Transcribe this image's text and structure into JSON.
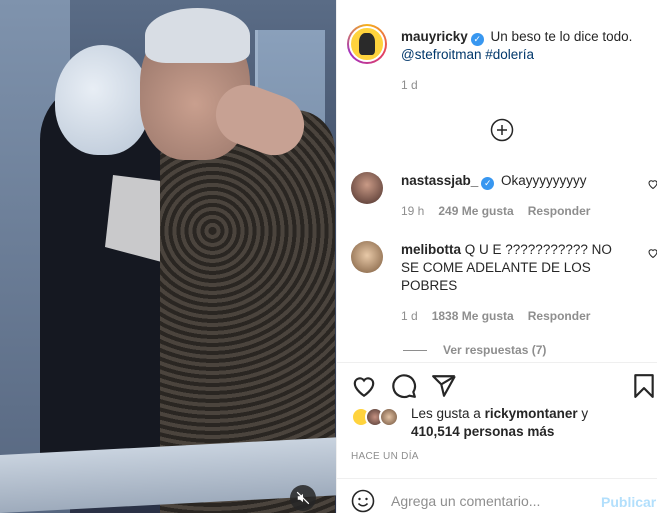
{
  "post": {
    "author": "mauyricky",
    "caption_text": " Un beso te lo dice todo.",
    "mention": "@stefroitman",
    "hashtag": "#dolería",
    "age": "1 d"
  },
  "comments": [
    {
      "username": "nastassjab_",
      "text": " Okayyyyyyyyy",
      "time": "19 h",
      "likes": "249 Me gusta",
      "reply_label": "Responder",
      "verified": true
    },
    {
      "username": "melibotta",
      "text": " Q U E ??????????? NO SE COME ADELANTE DE LOS POBRES",
      "time": "1 d",
      "likes": "1838 Me gusta",
      "reply_label": "Responder",
      "verified": false
    }
  ],
  "view_replies": "Ver respuestas (7)",
  "likes_summary": {
    "prefix": "Les gusta a ",
    "user": "rickymontaner",
    "middle": " y",
    "count": "410,514 personas más"
  },
  "post_age": "HACE UN DÍA",
  "add_comment": {
    "placeholder": "Agrega un comentario...",
    "publish_label": "Publicar"
  },
  "icons": {
    "verified": "verified-badge-icon",
    "load_more": "plus-circle-icon",
    "like": "heart-icon",
    "comment": "comment-icon",
    "share": "paper-plane-icon",
    "save": "bookmark-icon",
    "emoji": "smiley-icon",
    "mute": "speaker-muted-icon"
  },
  "colors": {
    "link": "#00376b",
    "verified": "#3897f0",
    "muted_text": "#8e8e8e",
    "publish_disabled": "#b2dffc"
  }
}
